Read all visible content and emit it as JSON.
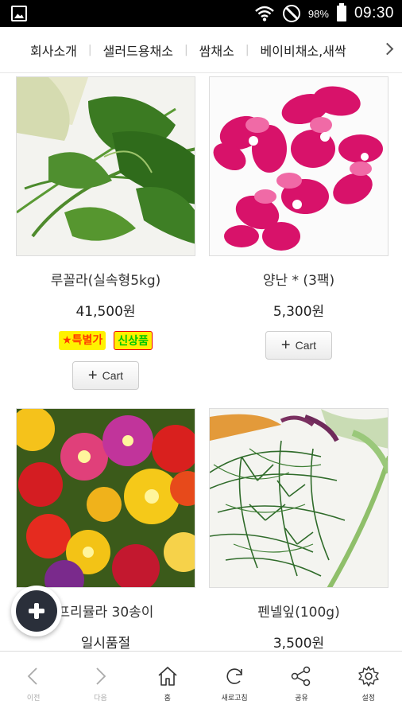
{
  "status_bar": {
    "battery": "98%",
    "time": "09:30"
  },
  "nav": {
    "items": [
      "회사소개",
      "샐러드용채소",
      "쌈채소",
      "베이비채소,새싹"
    ],
    "separator": "|"
  },
  "products": [
    {
      "name": "루꼴라(실속형5kg)",
      "price": "41,500원",
      "badges": [
        "★특별가",
        "신상품"
      ],
      "cart_label": "Cart"
    },
    {
      "name": "양난 * (3팩)",
      "price": "5,300원",
      "badges": [],
      "cart_label": "Cart"
    },
    {
      "name": "프리뮬라 30송이",
      "price": "일시품절",
      "badges": []
    },
    {
      "name": "펜넬잎(100g)",
      "price": "3,500원",
      "badges": []
    }
  ],
  "bottom_bar": {
    "back": "이전",
    "forward": "다음",
    "home": "홈",
    "refresh": "새로고침",
    "share": "공유",
    "settings": "설정"
  },
  "colors": {
    "fab": "#2a2f3a",
    "badge_special": "#ff3b00",
    "badge_new": "#00c800"
  }
}
